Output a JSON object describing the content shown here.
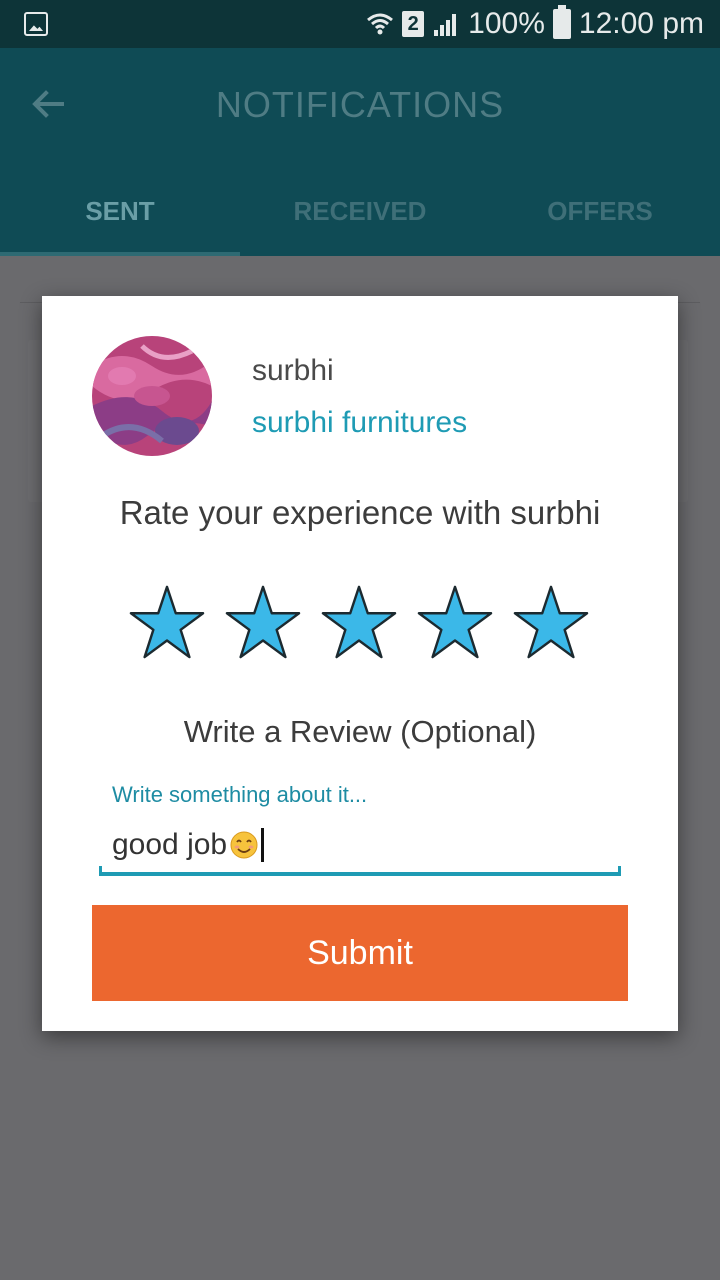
{
  "status_bar": {
    "sim_slot": "2",
    "battery": "100%",
    "time": "12:00 pm"
  },
  "app_bar": {
    "title": "NOTIFICATIONS"
  },
  "tabs": [
    {
      "label": "SENT",
      "active": true
    },
    {
      "label": "RECEIVED",
      "active": false
    },
    {
      "label": "OFFERS",
      "active": false
    }
  ],
  "dialog": {
    "user_name": "surbhi",
    "company_name": "surbhi furnitures",
    "rate_prompt": "Rate your experience with surbhi",
    "rating": 5,
    "max_rating": 5,
    "review_title": "Write a Review (Optional)",
    "review_field": {
      "label": "Write something about it...",
      "value": "good job"
    },
    "submit_label": "Submit"
  },
  "colors": {
    "accent": "#1e9bb4",
    "star": "#3bb8e8",
    "submit": "#ec672f",
    "app_bar": "#0f4b55"
  }
}
